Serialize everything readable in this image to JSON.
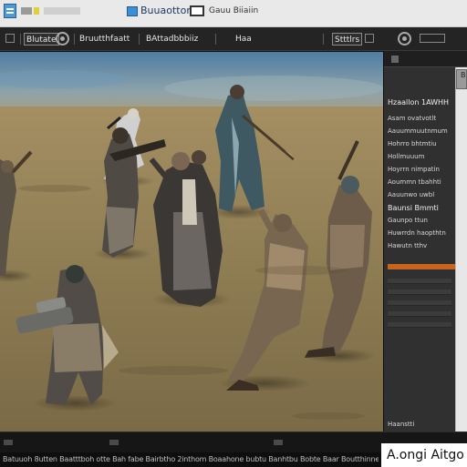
{
  "titlebar": {
    "doc_title": "Buuaotton",
    "subtitle": "Gauu Biiaiin"
  },
  "toolbar": {
    "items": [
      "Blutate",
      "Bruutthfaatt",
      "BAttadbbbiiz",
      "Haa",
      "Stttlrs"
    ]
  },
  "panel": {
    "header_label": "B",
    "section_title": "Hzaallon 1AWHH",
    "rows_a": [
      "Asam ovatvotlt",
      "Aauummuutnmum",
      "Hohrro bhtmtiu",
      "Hollmuuum",
      "Hoyrrn nimpatin",
      "Aoummn tbahhti",
      "Aauunwo uwbl"
    ],
    "section_title_2": "Baunsi Bmmti",
    "rows_b": [
      "Gaunpo ttun",
      "Huwrrdn haopthtn",
      "Hawutn tthv"
    ],
    "footer_label": "Haanstti"
  },
  "status": {
    "text": "Batuuoh 8utten Baatttboh otte Bah fabe Bairbtho 2inthom Boaahone bubtu Banhtbu Bobte Baar Boutthinne Bbonttn boktn"
  },
  "brand": "A.ongi Aitgo",
  "colors": {
    "accent": "#c9631d",
    "titlebar": "#e9e9e9",
    "panel": "#303030"
  }
}
